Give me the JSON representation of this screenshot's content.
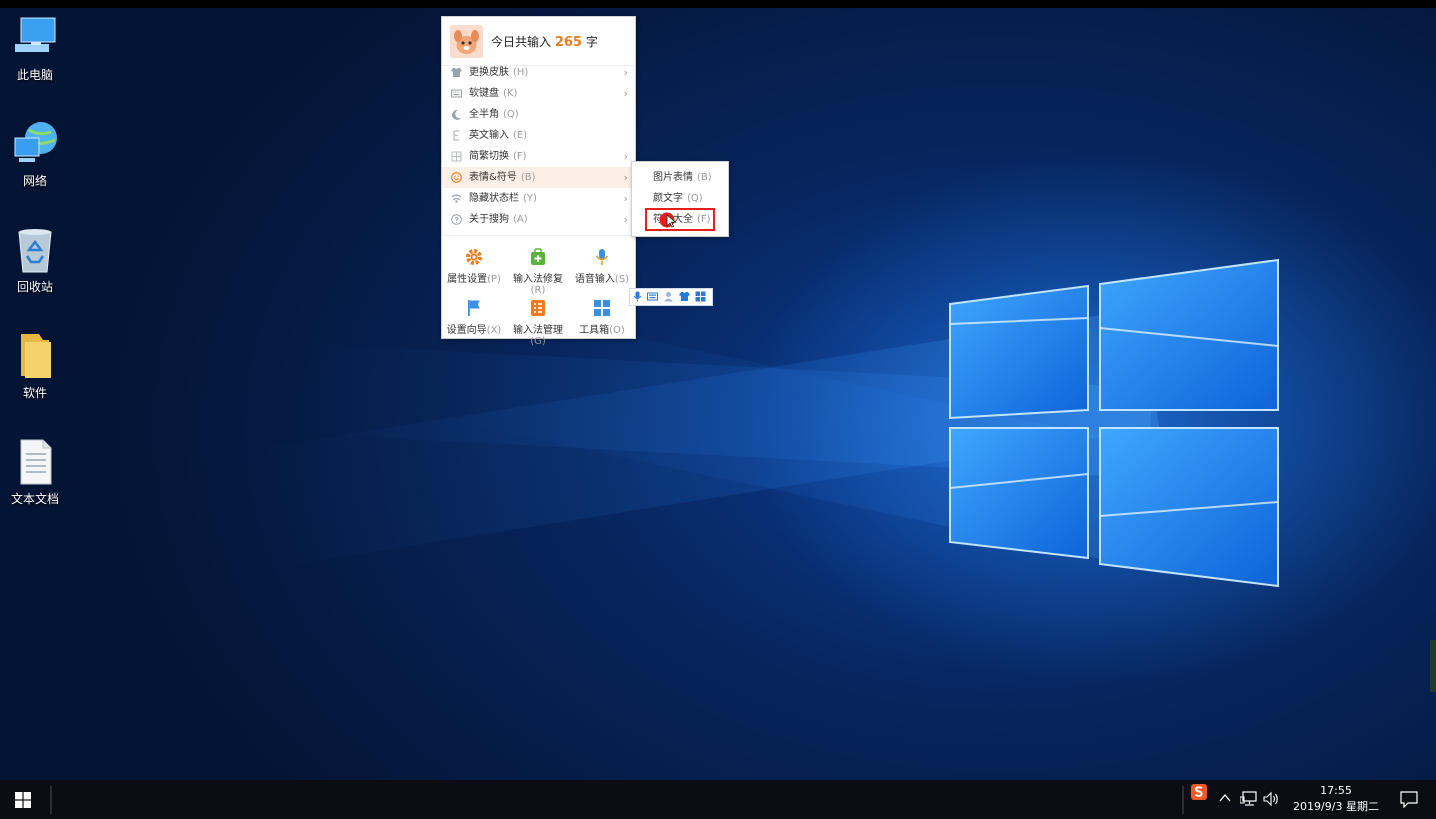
{
  "desktop": {
    "icons": [
      {
        "label": "此电脑",
        "icon": "computer-icon"
      },
      {
        "label": "网络",
        "icon": "network-icon"
      },
      {
        "label": "回收站",
        "icon": "recycle-bin-icon"
      },
      {
        "label": "软件",
        "icon": "folder-icon"
      },
      {
        "label": "文本文档",
        "icon": "text-document-icon"
      }
    ]
  },
  "ime_menu": {
    "header": {
      "prefix": "今日共输入",
      "count": "265",
      "suffix": "字"
    },
    "items": [
      {
        "label": "更换皮肤",
        "shortcut": "(H)",
        "icon": "shirt-icon",
        "has_submenu": true
      },
      {
        "label": "软键盘",
        "shortcut": "(K)",
        "icon": "keyboard-icon",
        "has_submenu": true
      },
      {
        "label": "全半角",
        "shortcut": "(Q)",
        "icon": "moon-icon",
        "has_submenu": false
      },
      {
        "label": "英文输入",
        "shortcut": "(E)",
        "icon": "english-icon",
        "has_submenu": false
      },
      {
        "label": "简繁切换",
        "shortcut": "(F)",
        "icon": "traditional-icon",
        "has_submenu": true
      },
      {
        "label": "表情&符号",
        "shortcut": "(B)",
        "icon": "smiley-icon",
        "has_submenu": true,
        "active": true
      },
      {
        "label": "隐藏状态栏",
        "shortcut": "(Y)",
        "icon": "hide-statusbar-icon",
        "has_submenu": true
      },
      {
        "label": "关于搜狗",
        "shortcut": "(A)",
        "icon": "question-icon",
        "has_submenu": true
      }
    ],
    "tools": [
      {
        "label": "属性设置",
        "shortcut": "(P)",
        "icon": "gear-icon",
        "color": "#f07b1f"
      },
      {
        "label": "输入法修复",
        "shortcut": "(R)",
        "icon": "repair-icon",
        "color": "#5ab43c"
      },
      {
        "label": "语音输入",
        "shortcut": "(S)",
        "icon": "microphone-icon",
        "color": "#3b8fe0"
      },
      {
        "label": "设置向导",
        "shortcut": "(X)",
        "icon": "flag-icon",
        "color": "#3b8fe0"
      },
      {
        "label": "输入法管理",
        "shortcut": "(G)",
        "icon": "manage-icon",
        "color": "#f07b1f"
      },
      {
        "label": "工具箱",
        "shortcut": "(O)",
        "icon": "toolbox-icon",
        "color": "#3b8fe0"
      }
    ]
  },
  "submenu": {
    "items": [
      {
        "label": "图片表情",
        "shortcut": "(B)"
      },
      {
        "label": "颜文字",
        "shortcut": "(Q)"
      },
      {
        "label": "符号大全",
        "shortcut": "(F)"
      }
    ]
  },
  "taskbar": {
    "time": "17:55",
    "date": "2019/9/3 星期二"
  },
  "colors": {
    "accent_orange": "#f07b1f",
    "highlight_red": "#e5201c",
    "active_item_bg": "#fdeee6"
  }
}
